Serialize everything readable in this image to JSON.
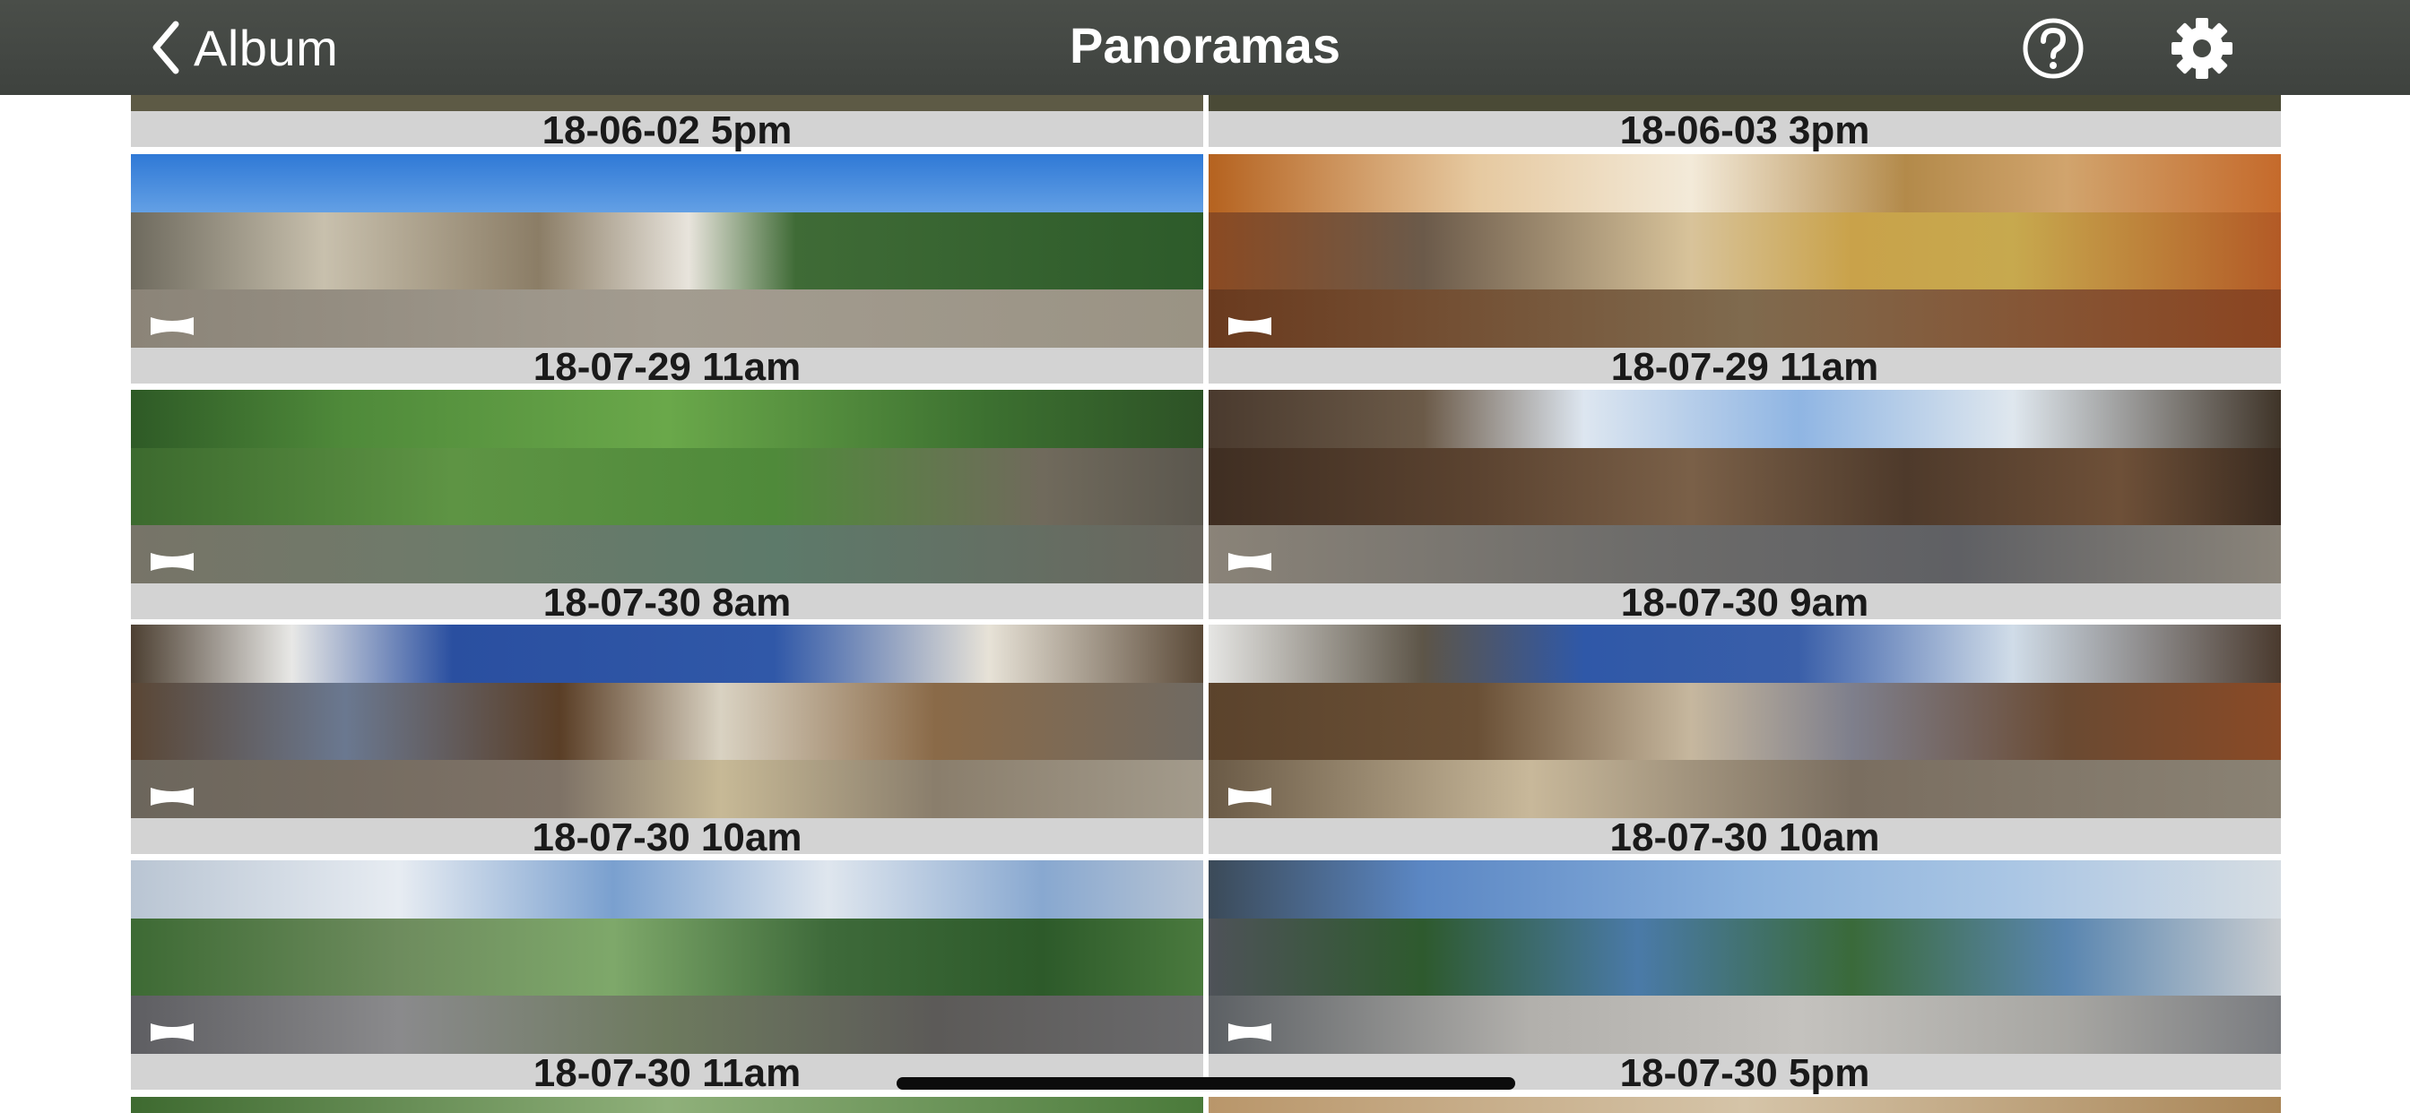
{
  "navbar": {
    "back_label": "Album",
    "title": "Panoramas",
    "back_icon": "chevron-left-icon",
    "help_icon": "question-circle-icon",
    "settings_icon": "gear-icon"
  },
  "gallery": {
    "top_labels": [
      "18-06-02 5pm",
      "18-06-03 3pm"
    ],
    "rows": [
      {
        "left": {
          "label": "18-07-29 11am",
          "theme": "castle"
        },
        "right": {
          "label": "18-07-29 11am",
          "theme": "interior"
        }
      },
      {
        "left": {
          "label": "18-07-30 8am",
          "theme": "river"
        },
        "right": {
          "label": "18-07-30 9am",
          "theme": "street"
        }
      },
      {
        "left": {
          "label": "18-07-30 10am",
          "theme": "shop"
        },
        "right": {
          "label": "18-07-30 10am",
          "theme": "shop"
        }
      },
      {
        "left": {
          "label": "18-07-30 11am",
          "theme": "hill"
        },
        "right": {
          "label": "18-07-30 5pm",
          "theme": "bay"
        }
      }
    ]
  },
  "colors": {
    "navbar": "#454944",
    "label_bar": "#d3d3d3",
    "label_text": "#1a1a1a",
    "background": "#ffffff"
  }
}
